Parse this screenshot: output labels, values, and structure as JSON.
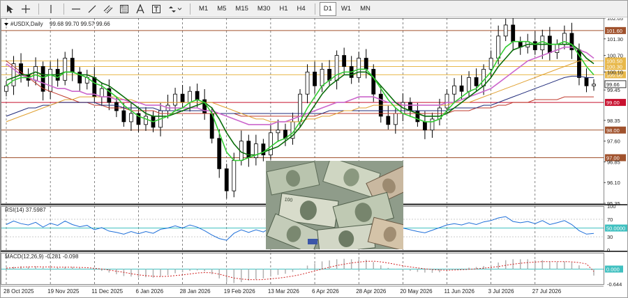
{
  "toolbar": {
    "timeframes": [
      "M1",
      "M5",
      "M15",
      "M30",
      "H1",
      "H4",
      "D1",
      "W1",
      "MN"
    ],
    "active_timeframe": "D1"
  },
  "chart_data": [
    {
      "type": "candlestick",
      "symbol_label": "#USDX,Daily",
      "ohlc_label": "99.68 99.70 99.57 99.66",
      "ylim": [
        95.35,
        102.05
      ],
      "y_ticks": [
        102.05,
        101.3,
        100.7,
        100.1,
        99.45,
        98.35,
        97.6,
        96.85,
        96.1,
        95.35
      ],
      "x_labels": [
        "28 Oct 2025",
        "19 Nov 2025",
        "11 Dec 2025",
        "6 Jan 2026",
        "28 Jan 2026",
        "19 Feb 2026",
        "13 Mar 2026",
        "6 Apr 2026",
        "28 Apr 2026",
        "20 May 2026",
        "11 Jun 2026",
        "3 Jul 2026",
        "27 Jul 2026"
      ],
      "horizontal_levels": [
        {
          "value": 101.6,
          "label": "101.60",
          "color": "#a0522d"
        },
        {
          "value": 100.5,
          "label": "100.50",
          "color": "#e8b84a"
        },
        {
          "value": 100.3,
          "label": "100.30",
          "color": "#e8b84a"
        },
        {
          "value": 100.0,
          "label": "100.00",
          "color": "#e8b84a"
        },
        {
          "value": 99.0,
          "label": "99.00",
          "color": "#c8102e"
        },
        {
          "value": 98.0,
          "label": "98.00",
          "color": "#a0522d"
        },
        {
          "value": 97.0,
          "label": "97.00",
          "color": "#a0522d"
        }
      ],
      "last_price": {
        "value": 99.66,
        "label": "99.66"
      },
      "closes": [
        99.6,
        100.4,
        100.0,
        99.8,
        100.3,
        99.4,
        100.2,
        99.8,
        100.6,
        100.1,
        99.7,
        99.9,
        99.2,
        99.5,
        99.0,
        98.7,
        98.3,
        98.6,
        98.2,
        98.5,
        98.1,
        98.7,
        98.9,
        99.3,
        99.0,
        99.4,
        99.1,
        98.6,
        97.7,
        96.6,
        95.8,
        96.9,
        97.6,
        97.0,
        97.5,
        97.1,
        97.9,
        98.0,
        97.7,
        98.3,
        99.3,
        100.1,
        99.6,
        100.2,
        99.8,
        100.7,
        100.3,
        99.9,
        100.6,
        100.2,
        99.3,
        98.5,
        98.2,
        98.6,
        99.0,
        98.7,
        98.3,
        98.0,
        98.4,
        98.8,
        99.3,
        99.6,
        99.4,
        99.9,
        99.6,
        100.2,
        100.6,
        101.4,
        101.8,
        101.2,
        101.0,
        101.2,
        100.9,
        101.4,
        100.8,
        101.1,
        101.5,
        100.9,
        99.9,
        99.6,
        99.66
      ],
      "sma_short": [
        99.6,
        99.8,
        99.9,
        99.9,
        100.0,
        99.9,
        100.0,
        99.9,
        100.1,
        100.1,
        100.0,
        99.9,
        99.7,
        99.6,
        99.4,
        99.2,
        98.9,
        98.7,
        98.5,
        98.4,
        98.3,
        98.4,
        98.5,
        98.7,
        98.8,
        99.0,
        99.1,
        99.0,
        98.6,
        97.9,
        97.2,
        96.9,
        96.9,
        97.0,
        97.1,
        97.2,
        97.4,
        97.6,
        97.7,
        97.9,
        98.3,
        98.8,
        99.2,
        99.6,
        99.8,
        100.0,
        100.1,
        100.1,
        100.2,
        100.2,
        99.9,
        99.5,
        99.1,
        98.8,
        98.6,
        98.5,
        98.4,
        98.3,
        98.3,
        98.4,
        98.7,
        99.0,
        99.2,
        99.4,
        99.5,
        99.8,
        100.1,
        100.6,
        101.0,
        101.2,
        101.2,
        101.2,
        101.1,
        101.2,
        101.1,
        101.1,
        101.2,
        101.1,
        100.7,
        100.3,
        100.0
      ],
      "sma_mid": [
        99.8,
        99.9,
        100.0,
        100.0,
        100.1,
        100.0,
        100.0,
        100.0,
        100.1,
        100.1,
        100.0,
        100.0,
        99.9,
        99.7,
        99.6,
        99.4,
        99.2,
        99.0,
        98.8,
        98.6,
        98.5,
        98.5,
        98.5,
        98.6,
        98.7,
        98.8,
        98.9,
        99.0,
        98.8,
        98.4,
        97.9,
        97.5,
        97.2,
        97.1,
        97.1,
        97.2,
        97.3,
        97.4,
        97.6,
        97.8,
        98.1,
        98.5,
        98.9,
        99.3,
        99.6,
        99.8,
        100.0,
        100.0,
        100.1,
        100.1,
        99.9,
        99.6,
        99.3,
        99.0,
        98.8,
        98.7,
        98.6,
        98.5,
        98.5,
        98.5,
        98.6,
        98.8,
        99.0,
        99.2,
        99.4,
        99.6,
        99.9,
        100.3,
        100.6,
        100.9,
        101.0,
        101.1,
        101.1,
        101.1,
        101.1,
        101.1,
        101.1,
        101.1,
        100.9,
        100.6,
        100.4
      ],
      "sma_long": [
        100.4,
        100.2,
        100.0,
        99.9,
        99.8,
        99.7,
        99.6,
        99.5,
        99.5,
        99.4,
        99.4,
        99.3,
        99.3,
        99.2,
        99.2,
        99.1,
        99.1,
        99.0,
        99.0,
        98.9,
        98.9,
        98.9,
        98.8,
        98.8,
        98.8,
        98.8,
        98.8,
        98.7,
        98.7,
        98.6,
        98.5,
        98.4,
        98.3,
        98.2,
        98.2,
        98.2,
        98.2,
        98.3,
        98.3,
        98.4,
        98.5,
        98.6,
        98.7,
        98.8,
        98.9,
        99.0,
        99.0,
        99.1,
        99.2,
        99.2,
        99.2,
        99.1,
        99.0,
        99.0,
        98.9,
        98.9,
        98.9,
        98.9,
        98.9,
        98.9,
        99.0,
        99.0,
        99.1,
        99.2,
        99.3,
        99.4,
        99.5,
        99.7,
        99.9,
        100.1,
        100.3,
        100.5,
        100.6,
        100.7,
        100.8,
        100.9,
        101.0,
        101.0,
        100.9,
        100.8,
        100.6
      ],
      "ma_orange": [
        98.3,
        98.4,
        98.5,
        98.6,
        98.7,
        98.8,
        98.9,
        99.0,
        99.1,
        99.1,
        99.2,
        99.2,
        99.2,
        99.2,
        99.2,
        99.2,
        99.1,
        99.1,
        99.0,
        99.0,
        99.0,
        99.0,
        99.0,
        99.0,
        99.0,
        99.0,
        99.0,
        99.0,
        99.0,
        98.9,
        98.8,
        98.7,
        98.6,
        98.5,
        98.4,
        98.4,
        98.3,
        98.3,
        98.3,
        98.3,
        98.3,
        98.4,
        98.4,
        98.5,
        98.5,
        98.6,
        98.7,
        98.7,
        98.8,
        98.8,
        98.9,
        98.9,
        98.9,
        98.9,
        98.9,
        98.9,
        98.9,
        98.9,
        98.9,
        98.9,
        98.9,
        99.0,
        99.0,
        99.0,
        99.1,
        99.2,
        99.3,
        99.4,
        99.5,
        99.6,
        99.7,
        99.8,
        99.9,
        100.0,
        100.1,
        100.2,
        100.3,
        100.4,
        100.5,
        100.5,
        100.5
      ],
      "ma_navy": [
        98.5,
        98.6,
        98.7,
        98.8,
        98.8,
        98.9,
        98.9,
        99.0,
        99.0,
        99.0,
        99.0,
        99.0,
        99.0,
        98.9,
        98.9,
        98.9,
        98.8,
        98.8,
        98.8,
        98.8,
        98.8,
        98.7,
        98.7,
        98.7,
        98.7,
        98.7,
        98.7,
        98.7,
        98.7,
        98.6,
        98.6,
        98.6,
        98.6,
        98.6,
        98.6,
        98.6,
        98.6,
        98.6,
        98.6,
        98.6,
        98.6,
        98.6,
        98.6,
        98.6,
        98.7,
        98.7,
        98.7,
        98.7,
        98.7,
        98.7,
        98.7,
        98.7,
        98.7,
        98.7,
        98.7,
        98.7,
        98.7,
        98.7,
        98.7,
        98.7,
        98.7,
        98.8,
        98.8,
        98.8,
        98.8,
        98.9,
        98.9,
        99.0,
        99.1,
        99.2,
        99.3,
        99.4,
        99.5,
        99.6,
        99.7,
        99.8,
        99.9,
        99.95,
        99.95,
        99.9,
        99.9
      ],
      "ma_red": [
        100.5,
        100.3,
        100.1,
        99.9,
        99.7,
        99.5,
        99.4,
        99.3,
        99.2,
        99.1,
        99.0,
        99.0,
        98.9,
        98.9,
        98.8,
        98.8,
        98.8,
        98.7,
        98.7,
        98.7,
        98.7,
        98.6,
        98.6,
        98.6,
        98.6,
        98.6,
        98.6,
        98.6,
        98.6,
        98.6,
        98.6,
        98.6,
        98.5,
        98.5,
        98.5,
        98.5,
        98.5,
        98.5,
        98.5,
        98.5,
        98.5,
        98.5,
        98.5,
        98.6,
        98.6,
        98.6,
        98.6,
        98.6,
        98.6,
        98.6,
        98.6,
        98.6,
        98.6,
        98.6,
        98.6,
        98.6,
        98.6,
        98.6,
        98.6,
        98.6,
        98.6,
        98.7,
        98.7,
        98.7,
        98.8,
        98.8,
        98.8,
        98.9,
        98.9,
        99.0,
        99.0,
        99.0,
        99.1,
        99.1,
        99.1,
        99.1,
        99.2,
        99.2,
        99.2,
        99.2,
        99.2
      ]
    },
    {
      "type": "line",
      "label": "RSI(14) 37.5987",
      "ylim": [
        0,
        100
      ],
      "y_ticks": [
        100,
        70,
        50,
        30,
        0
      ],
      "level": {
        "value": 50,
        "label": "50.0000"
      },
      "values": [
        58,
        66,
        60,
        57,
        63,
        52,
        61,
        56,
        66,
        58,
        53,
        56,
        46,
        51,
        43,
        40,
        36,
        42,
        37,
        42,
        38,
        47,
        50,
        55,
        50,
        57,
        52,
        44,
        34,
        26,
        22,
        38,
        46,
        40,
        46,
        41,
        51,
        52,
        48,
        55,
        64,
        70,
        61,
        66,
        60,
        68,
        62,
        57,
        65,
        59,
        47,
        40,
        38,
        44,
        50,
        46,
        42,
        39,
        45,
        51,
        57,
        60,
        57,
        62,
        58,
        64,
        67,
        73,
        76,
        65,
        62,
        65,
        60,
        67,
        58,
        62,
        67,
        58,
        44,
        36,
        37.6
      ]
    },
    {
      "type": "bar",
      "label": "MACD(12,26,9) -0.281 -0.098",
      "ylim": [
        -0.644,
        0.7
      ],
      "y_ticks": [
        0.0,
        -0.644
      ],
      "level": {
        "value": 0,
        "label": "0.000"
      },
      "histogram": [
        0.05,
        0.1,
        0.12,
        0.1,
        0.12,
        0.06,
        0.08,
        0.06,
        0.1,
        0.09,
        0.04,
        0.02,
        -0.06,
        -0.08,
        -0.15,
        -0.22,
        -0.3,
        -0.32,
        -0.36,
        -0.35,
        -0.37,
        -0.32,
        -0.26,
        -0.18,
        -0.14,
        -0.08,
        -0.06,
        -0.1,
        -0.22,
        -0.4,
        -0.55,
        -0.6,
        -0.56,
        -0.5,
        -0.44,
        -0.4,
        -0.32,
        -0.25,
        -0.2,
        -0.12,
        0.02,
        0.15,
        0.24,
        0.33,
        0.37,
        0.42,
        0.44,
        0.42,
        0.42,
        0.4,
        0.3,
        0.16,
        0.05,
        -0.02,
        -0.05,
        -0.08,
        -0.12,
        -0.15,
        -0.16,
        -0.14,
        -0.08,
        -0.02,
        0.02,
        0.06,
        0.09,
        0.13,
        0.18,
        0.28,
        0.38,
        0.42,
        0.42,
        0.42,
        0.38,
        0.38,
        0.32,
        0.3,
        0.32,
        0.28,
        0.16,
        0.02,
        -0.28
      ],
      "signal": [
        0.04,
        0.06,
        0.08,
        0.09,
        0.1,
        0.09,
        0.09,
        0.08,
        0.08,
        0.08,
        0.07,
        0.06,
        0.03,
        0.0,
        -0.04,
        -0.09,
        -0.14,
        -0.2,
        -0.25,
        -0.28,
        -0.31,
        -0.32,
        -0.31,
        -0.28,
        -0.25,
        -0.21,
        -0.17,
        -0.15,
        -0.16,
        -0.22,
        -0.3,
        -0.38,
        -0.43,
        -0.45,
        -0.46,
        -0.45,
        -0.42,
        -0.39,
        -0.35,
        -0.3,
        -0.24,
        -0.16,
        -0.08,
        0.0,
        0.08,
        0.15,
        0.21,
        0.26,
        0.3,
        0.33,
        0.34,
        0.31,
        0.26,
        0.2,
        0.14,
        0.09,
        0.05,
        0.01,
        -0.02,
        -0.04,
        -0.05,
        -0.04,
        -0.03,
        -0.01,
        0.01,
        0.04,
        0.07,
        0.11,
        0.16,
        0.21,
        0.25,
        0.28,
        0.3,
        0.32,
        0.32,
        0.32,
        0.32,
        0.31,
        0.28,
        0.22,
        -0.1
      ]
    }
  ]
}
